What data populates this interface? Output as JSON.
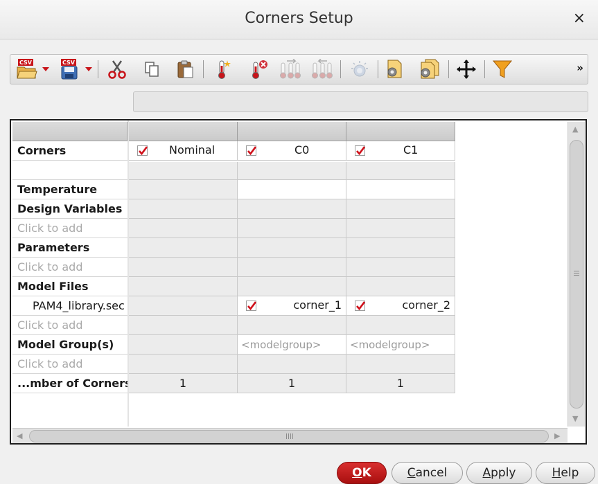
{
  "window": {
    "title": "Corners Setup",
    "close_glyph": "×"
  },
  "toolbar": {
    "csv_label": "CSV",
    "more_glyph": "»",
    "icons": [
      "csv-open-icon",
      "dropdown-arrow-icon",
      "csv-save-icon",
      "dropdown-arrow-icon",
      "cut-icon",
      "copy-icon",
      "paste-icon",
      "add-temperature-icon",
      "delete-temperature-icon",
      "temperature-sweep-right-icon",
      "temperature-sweep-left-icon",
      "light-bulb-icon",
      "config-icon",
      "config-multi-icon",
      "move-icon",
      "filter-icon"
    ]
  },
  "table": {
    "corners_label": "Corners",
    "columns": [
      {
        "name": "Nominal",
        "checked": true
      },
      {
        "name": "C0",
        "checked": true
      },
      {
        "name": "C1",
        "checked": true
      }
    ],
    "rows": {
      "temperature": "Temperature",
      "design_variables": "Design Variables",
      "parameters": "Parameters",
      "model_files": "Model Files",
      "model_file_name": "PAM4_library.sec",
      "model_groups": "Model Group(s)",
      "number_of_corners": "...mber of Corners"
    },
    "click_to_add": "Click to add",
    "model_file_values": [
      "",
      "corner_1",
      "corner_2"
    ],
    "model_group_placeholder": "<modelgroup>",
    "corner_counts": [
      "1",
      "1",
      "1"
    ]
  },
  "buttons": {
    "ok": {
      "letter": "O",
      "rest": "K"
    },
    "cancel": {
      "letter": "C",
      "rest": "ancel"
    },
    "apply": {
      "letter": "A",
      "rest": "pply"
    },
    "help": {
      "letter": "H",
      "rest": "elp"
    }
  },
  "colors": {
    "accent_red": "#c01a1a",
    "check_red": "#d0101a"
  }
}
